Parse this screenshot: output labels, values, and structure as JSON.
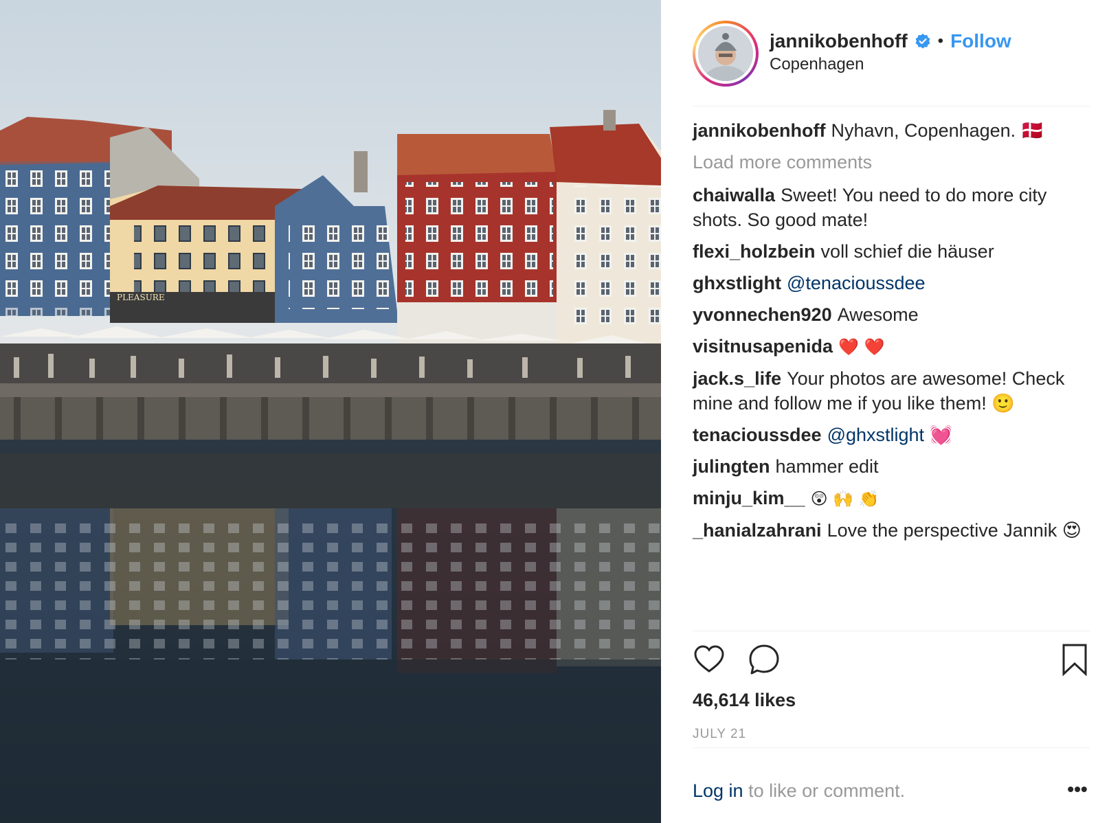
{
  "post": {
    "username": "jannikobenhoff",
    "follow_label": "Follow",
    "separator": "•",
    "location": "Copenhagen",
    "verified": true
  },
  "caption": {
    "user": "jannikobenhoff",
    "text": "Nyhavn, Copenhagen. 🇩🇰"
  },
  "load_more_label": "Load more comments",
  "comments": [
    {
      "user": "chaiwalla",
      "text": "Sweet! You need to do more city shots. So good mate!"
    },
    {
      "user": "flexi_holzbein",
      "text": "voll schief die häuser"
    },
    {
      "user": "ghxstlight",
      "text": "@tenacioussdee"
    },
    {
      "user": "yvonnechen920",
      "text": "Awesome"
    },
    {
      "user": "visitnusapenida",
      "text": "❤️ ❤️"
    },
    {
      "user": "jack.s_life",
      "text": "Your photos are awesome! Check mine and follow me if you like them! 🙂"
    },
    {
      "user": "tenacioussdee",
      "text": "@ghxstlight 💓"
    },
    {
      "user": "julingten",
      "text": "hammer edit"
    },
    {
      "user": "minju_kim__",
      "text": "😲 🙌 👏"
    },
    {
      "user": "_hanialzahrani",
      "text": "Love the perspective Jannik 😍"
    }
  ],
  "likes_label": "46,614 likes",
  "date_label": "JULY 21",
  "login": {
    "link": "Log in",
    "rest": " to like or comment.",
    "more": "•••"
  },
  "colors": {
    "accent": "#3897f0",
    "link": "#003569",
    "muted": "#999999",
    "text": "#262626"
  },
  "icons": [
    "heart-icon",
    "comment-icon",
    "bookmark-icon",
    "verified-badge-icon",
    "more-options-icon"
  ]
}
